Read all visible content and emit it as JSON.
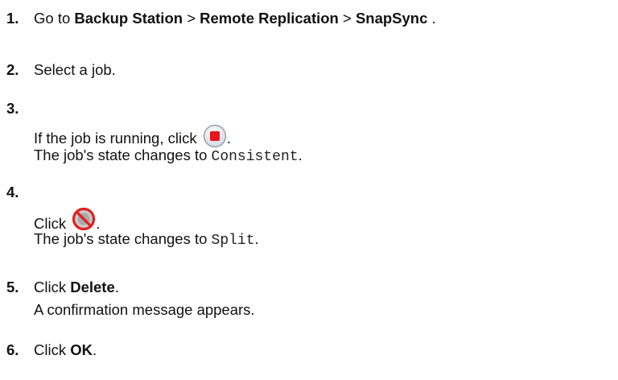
{
  "steps": [
    {
      "number": "1.",
      "parts": {
        "prefix": "Go to",
        "link1": "Backup Station",
        "sep1": ">",
        "link2": "Remote Replication",
        "sep2": ">",
        "link3": "SnapSync",
        "suffix": "."
      }
    },
    {
      "number": "2.",
      "text": "Select a job."
    },
    {
      "number": "3.",
      "text": "If the job is running, click",
      "icon": "stop-button-icon",
      "after_icon": ".",
      "result_prefix": "The job's state changes to",
      "result_value": "Consistent",
      "result_suffix": "."
    },
    {
      "number": "4.",
      "text": "Click",
      "icon": "split-prohibited-icon",
      "after_icon": ".",
      "result_prefix": "The job's state changes to",
      "result_value": "Split",
      "result_suffix": "."
    },
    {
      "number": "5.",
      "text": "Click",
      "bold": "Delete",
      "suffix": ".",
      "result": "A confirmation message appears."
    },
    {
      "number": "6.",
      "text": "Click",
      "bold": "OK",
      "suffix": "."
    }
  ],
  "colors": {
    "stop_red": "#e8141e",
    "prohibited_red": "#e0201e",
    "icon_gray": "#b8b8b8"
  }
}
